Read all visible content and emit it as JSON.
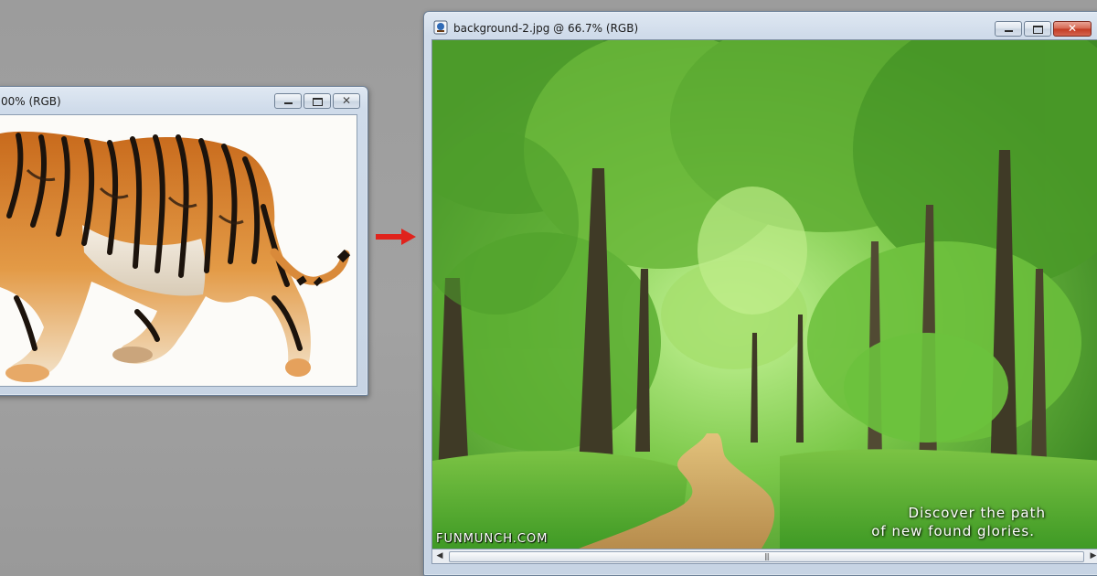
{
  "tiger_window": {
    "title": "00% (RGB)"
  },
  "forest_window": {
    "title": "background-2.jpg @ 66.7% (RGB)",
    "caption_line1": "Discover the path",
    "caption_line2": "of new found glories.",
    "watermark": "FUNMUNCH.COM"
  },
  "icons": {
    "minimize": "minimize-icon",
    "maximize": "maximize-icon",
    "close": "close-icon",
    "arrow": "right-arrow-icon",
    "document": "photoshop-document-icon",
    "scroll_left": "scroll-left-arrow-icon",
    "scroll_right": "scroll-right-arrow-icon",
    "close_glyph": "✕",
    "left_glyph": "◀",
    "right_glyph": "▶",
    "grip_glyph": "|||"
  },
  "colors": {
    "desktop": "#a0a0a0",
    "arrow": "#e0231c",
    "close_button": "#c23a22",
    "foliage": "#5aa83a"
  }
}
